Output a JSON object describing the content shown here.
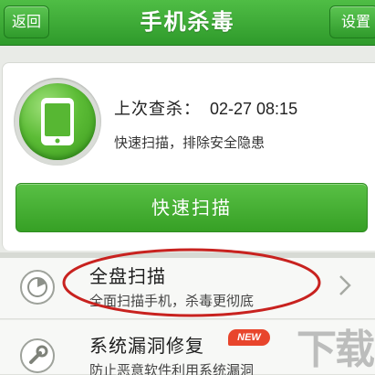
{
  "topbar": {
    "back_label": "返回",
    "title": "手机杀毒",
    "settings_label": "设置"
  },
  "status": {
    "last_scan_label": "上次查杀：",
    "last_scan_time": "02-27 08:15",
    "subtitle": "快速扫描，排除安全隐患"
  },
  "quick_scan": {
    "label": "快速扫描"
  },
  "list": [
    {
      "title": "全盘扫描",
      "subtitle": "全面扫描手机，杀毒更彻底",
      "icon": "radar-icon"
    },
    {
      "title": "系统漏洞修复",
      "subtitle": "防止恶意软件利用系统漏洞",
      "badge": "NEW",
      "icon": "wrench-icon"
    }
  ],
  "watermark": "下载",
  "colors": {
    "accent": "#3aa52d",
    "highlight": "#c8221f",
    "badge": "#e8452c"
  }
}
